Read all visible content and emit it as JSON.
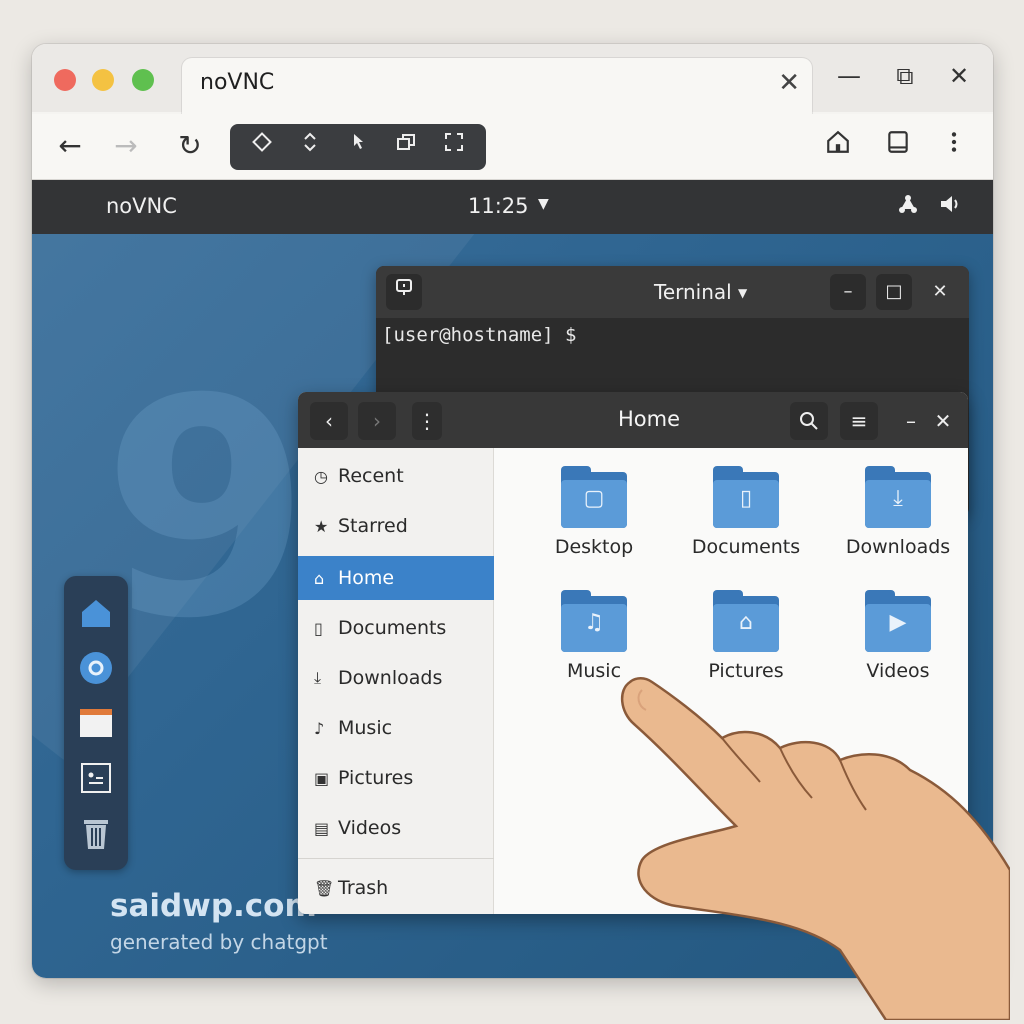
{
  "browser": {
    "tab_title": "noVNC",
    "tab_close": "✕",
    "window_controls": [
      "—",
      "⧉",
      "✕"
    ],
    "nav": {
      "back": "←",
      "forward": "→",
      "reload": "↻"
    },
    "novnc_toolbar_icons": [
      "diamond-icon",
      "updown-icon",
      "cursor-icon",
      "windows-icon",
      "fullscreen-icon"
    ],
    "right_icons": [
      "home-icon",
      "tablet-icon",
      "more-icon"
    ]
  },
  "desktop": {
    "topbar": {
      "title": "noVNC",
      "clock": "11:25"
    },
    "dock_items": [
      "home-icon",
      "settings-icon",
      "browser-icon",
      "terminal-icon",
      "trash-icon"
    ],
    "watermark_1": "saidwp.com",
    "watermark_2": "generated by chatgpt"
  },
  "terminal": {
    "title": "Terninal",
    "prompt": "[user@hostname] $"
  },
  "files": {
    "title": "Home",
    "sidebar": [
      {
        "label": "Recent",
        "icon": "clock-icon"
      },
      {
        "label": "Starred",
        "icon": "star-icon"
      },
      {
        "label": "Home",
        "icon": "home-icon",
        "active": true
      },
      {
        "label": "Documents",
        "icon": "document-icon"
      },
      {
        "label": "Downloads",
        "icon": "download-icon"
      },
      {
        "label": "Music",
        "icon": "music-icon"
      },
      {
        "label": "Pictures",
        "icon": "picture-icon"
      },
      {
        "label": "Videos",
        "icon": "video-icon"
      },
      {
        "label": "Trash",
        "icon": "trash-icon"
      }
    ],
    "folders": [
      {
        "label": "Desktop",
        "icon": "desktop-icon"
      },
      {
        "label": "Documents",
        "icon": "document-icon"
      },
      {
        "label": "Downloads",
        "icon": "download-icon"
      },
      {
        "label": "Music",
        "icon": "music-icon"
      },
      {
        "label": "Pictures",
        "icon": "picture-icon"
      },
      {
        "label": "Videos",
        "icon": "video-icon"
      }
    ]
  },
  "colors": {
    "accent": "#3b82c9",
    "folder": "#5b9bd8",
    "desktop_bg": "#2f6591"
  }
}
